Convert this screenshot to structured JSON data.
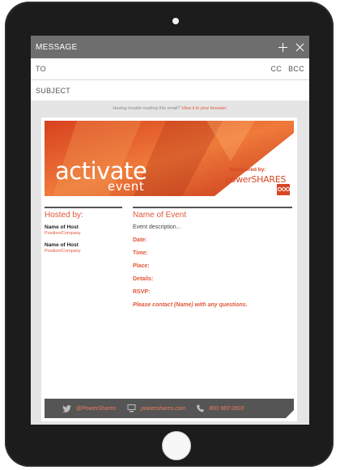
{
  "message_header": {
    "title": "MESSAGE"
  },
  "fields": {
    "to_label": "TO",
    "cc_label": "CC",
    "bcc_label": "BCC",
    "subject_label": "SUBJECT"
  },
  "email": {
    "trouble_text": "Having trouble reading this email?",
    "trouble_link": "View it in your browser.",
    "banner": {
      "title": "activate",
      "subtitle": "event",
      "sponsor_label": "Sponsored by:",
      "sponsor_name": "powerSHARES"
    },
    "hosted_by_title": "Hosted by:",
    "hosts": [
      {
        "name": "Name of Host",
        "position": "Position/Company"
      },
      {
        "name": "Name of Host",
        "position": "Position/Company"
      }
    ],
    "event_name": "Name of Event",
    "event_description": "Event description...",
    "details": {
      "date": "Date:",
      "time": "Time:",
      "place": "Place:",
      "details": "Details:",
      "rsvp": "RSVP:"
    },
    "contact_line": "Please contact (Name) with any questions.",
    "footer": {
      "twitter": "@PowerShares",
      "website": "powershares.com",
      "phone": "800 983 0903"
    }
  },
  "colors": {
    "accent": "#e0573a",
    "header_bg": "#6e6e6e",
    "footer_bg": "#555555",
    "tablet": "#1c1c1c"
  },
  "icons": [
    "plus-icon",
    "close-icon",
    "twitter-icon",
    "computer-icon",
    "phone-icon"
  ]
}
